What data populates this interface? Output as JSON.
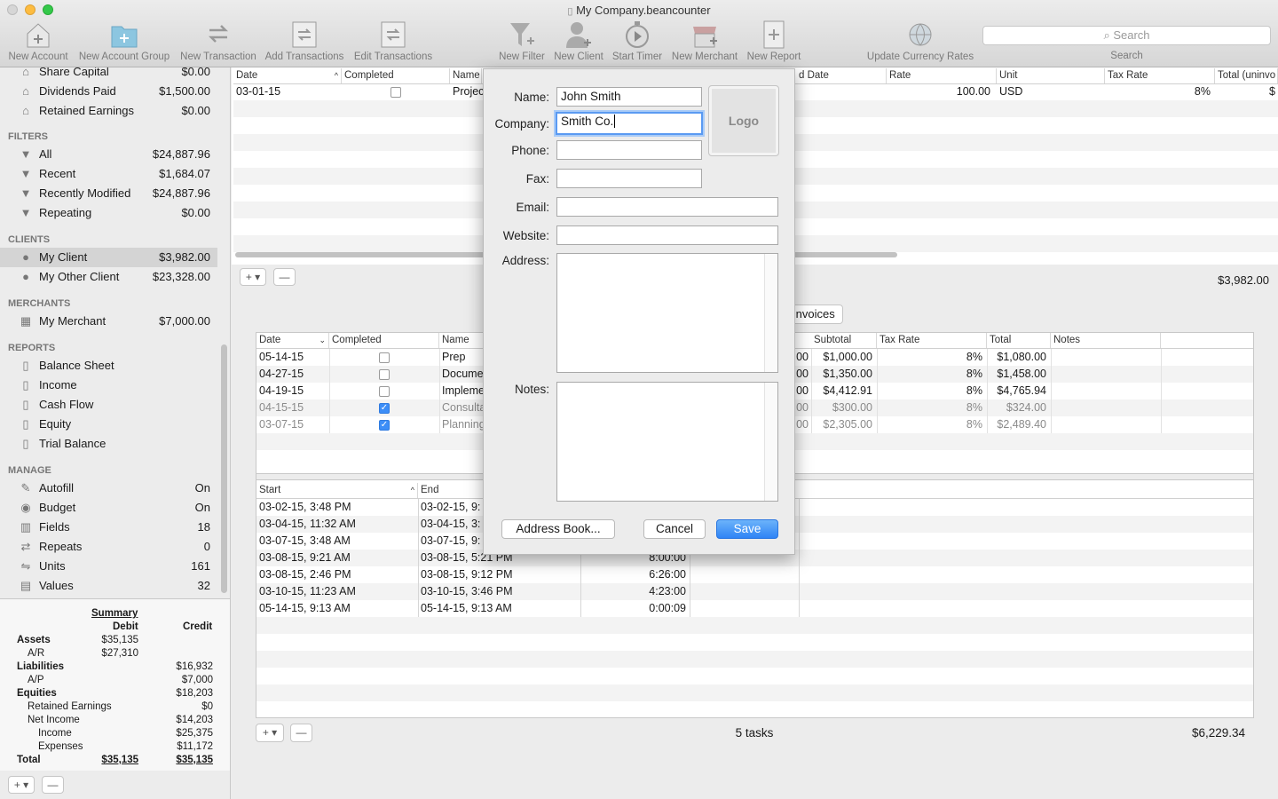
{
  "window": {
    "title": "My Company.beancounter"
  },
  "toolbar": {
    "items": [
      {
        "label": "New Account",
        "icon": "new-account-icon"
      },
      {
        "label": "New Account Group",
        "icon": "new-account-group-icon"
      },
      {
        "label": "New Transaction",
        "icon": "new-transaction-icon"
      },
      {
        "label": "Add Transactions",
        "icon": "add-transactions-icon"
      },
      {
        "label": "Edit Transactions",
        "icon": "edit-transactions-icon"
      },
      {
        "label": "New Filter",
        "icon": "filter-icon"
      },
      {
        "label": "New Client",
        "icon": "client-icon"
      },
      {
        "label": "Start Timer",
        "icon": "timer-icon"
      },
      {
        "label": "New Merchant",
        "icon": "merchant-icon"
      },
      {
        "label": "New Report",
        "icon": "report-icon"
      },
      {
        "label": "Update Currency Rates",
        "icon": "globe-icon"
      }
    ],
    "search_placeholder": "Search",
    "search_label": "Search"
  },
  "sidebar": {
    "accounts": [
      {
        "label": "Share Capital",
        "value": "$0.00"
      },
      {
        "label": "Dividends Paid",
        "value": "$1,500.00"
      },
      {
        "label": "Retained Earnings",
        "value": "$0.00"
      }
    ],
    "filters_header": "FILTERS",
    "filters": [
      {
        "label": "All",
        "value": "$24,887.96"
      },
      {
        "label": "Recent",
        "value": "$1,684.07"
      },
      {
        "label": "Recently Modified",
        "value": "$24,887.96"
      },
      {
        "label": "Repeating",
        "value": "$0.00"
      }
    ],
    "clients_header": "CLIENTS",
    "clients": [
      {
        "label": "My Client",
        "value": "$3,982.00"
      },
      {
        "label": "My Other Client",
        "value": "$23,328.00"
      }
    ],
    "merchants_header": "MERCHANTS",
    "merchants": [
      {
        "label": "My Merchant",
        "value": "$7,000.00"
      }
    ],
    "reports_header": "REPORTS",
    "reports": [
      {
        "label": "Balance Sheet"
      },
      {
        "label": "Income"
      },
      {
        "label": "Cash Flow"
      },
      {
        "label": "Equity"
      },
      {
        "label": "Trial Balance"
      }
    ],
    "manage_header": "MANAGE",
    "manage": [
      {
        "label": "Autofill",
        "value": "On"
      },
      {
        "label": "Budget",
        "value": "On"
      },
      {
        "label": "Fields",
        "value": "18"
      },
      {
        "label": "Repeats",
        "value": "0"
      },
      {
        "label": "Units",
        "value": "161"
      },
      {
        "label": "Values",
        "value": "32"
      }
    ]
  },
  "summary": {
    "title": "Summary",
    "debit_header": "Debit",
    "credit_header": "Credit",
    "rows": [
      {
        "label": "Assets",
        "debit": "$35,135",
        "credit": "",
        "indent": 0,
        "bold": true
      },
      {
        "label": "A/R",
        "debit": "$27,310",
        "credit": "",
        "indent": 1,
        "bold": false
      },
      {
        "label": "Liabilities",
        "debit": "",
        "credit": "$16,932",
        "indent": 0,
        "bold": true
      },
      {
        "label": "A/P",
        "debit": "",
        "credit": "$7,000",
        "indent": 1,
        "bold": false
      },
      {
        "label": "Equities",
        "debit": "",
        "credit": "$18,203",
        "indent": 0,
        "bold": true
      },
      {
        "label": "Retained Earnings",
        "debit": "",
        "credit": "$0",
        "indent": 1,
        "bold": false
      },
      {
        "label": "Net Income",
        "debit": "",
        "credit": "$14,203",
        "indent": 1,
        "bold": false
      },
      {
        "label": "Income",
        "debit": "",
        "credit": "$25,375",
        "indent": 2,
        "bold": false
      },
      {
        "label": "Expenses",
        "debit": "",
        "credit": "$11,172",
        "indent": 2,
        "bold": false
      },
      {
        "label": "Total",
        "debit": "$35,135",
        "credit": "$35,135",
        "indent": 0,
        "bold": true
      }
    ]
  },
  "top_table": {
    "headers": [
      "Date",
      "Completed",
      "Name",
      "d Date",
      "Rate",
      "Unit",
      "Tax Rate",
      "Total (uninvo"
    ],
    "row": {
      "date": "03-01-15",
      "name": "Projec",
      "rate": "100.00",
      "unit": "USD",
      "tax": "8%",
      "total": "$"
    },
    "total": "$3,982.00"
  },
  "tabs": {
    "invoices": "Invoices"
  },
  "tasks_table": {
    "headers": [
      "Date",
      "Completed",
      "Name",
      "Subtotal",
      "Tax Rate",
      "Total",
      "Notes"
    ],
    "rows": [
      {
        "date": "05-14-15",
        "done": false,
        "name": "Prep",
        "p": ".00",
        "subtotal": "$1,000.00",
        "tax": "8%",
        "total": "$1,080.00"
      },
      {
        "date": "04-27-15",
        "done": false,
        "name": "Docume",
        "p": ".00",
        "subtotal": "$1,350.00",
        "tax": "8%",
        "total": "$1,458.00"
      },
      {
        "date": "04-19-15",
        "done": false,
        "name": "Impleme",
        "p": ".00",
        "subtotal": "$4,412.91",
        "tax": "8%",
        "total": "$4,765.94"
      },
      {
        "date": "04-15-15",
        "done": true,
        "name": "Consulta",
        "p": ".00",
        "subtotal": "$300.00",
        "tax": "8%",
        "total": "$324.00"
      },
      {
        "date": "03-07-15",
        "done": true,
        "name": "Planning",
        "p": ".00",
        "subtotal": "$2,305.00",
        "tax": "8%",
        "total": "$2,489.40"
      }
    ]
  },
  "time_table": {
    "headers": [
      "Start",
      "End"
    ],
    "rows": [
      {
        "start": "03-02-15, 3:48 PM",
        "end": "03-02-15, 9:",
        "dur": ""
      },
      {
        "start": "03-04-15, 11:32 AM",
        "end": "03-04-15, 3:",
        "dur": ""
      },
      {
        "start": "03-07-15, 3:48 AM",
        "end": "03-07-15, 9:",
        "dur": ""
      },
      {
        "start": "03-08-15, 9:21 AM",
        "end": "03-08-15, 5:21 PM",
        "dur": "8:00:00"
      },
      {
        "start": "03-08-15, 2:46 PM",
        "end": "03-08-15, 9:12 PM",
        "dur": "6:26:00"
      },
      {
        "start": "03-10-15, 11:23 AM",
        "end": "03-10-15, 3:46 PM",
        "dur": "4:23:00"
      },
      {
        "start": "05-14-15, 9:13 AM",
        "end": "05-14-15, 9:13 AM",
        "dur": "0:00:09"
      }
    ]
  },
  "footer": {
    "tasks_count": "5 tasks",
    "tasks_total": "$6,229.34"
  },
  "dialog": {
    "name_label": "Name:",
    "name_value": "John Smith",
    "company_label": "Company:",
    "company_value": "Smith Co.",
    "phone_label": "Phone:",
    "fax_label": "Fax:",
    "email_label": "Email:",
    "website_label": "Website:",
    "address_label": "Address:",
    "notes_label": "Notes:",
    "logo_label": "Logo",
    "address_book_button": "Address Book...",
    "cancel_button": "Cancel",
    "save_button": "Save"
  },
  "colors": {
    "accent": "#3d8ef7",
    "selection": "#d4d4d4"
  }
}
